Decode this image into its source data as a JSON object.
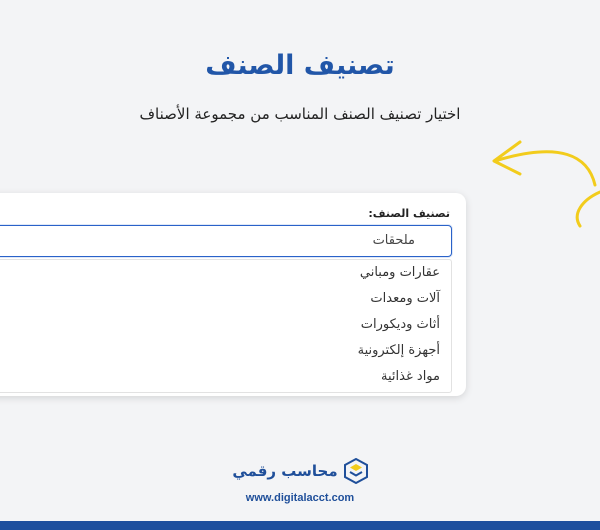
{
  "header": {
    "title": "تصنيف الصنف",
    "subtitle": "اختيار تصنيف الصنف المناسب من مجموعة الأصناف"
  },
  "form": {
    "field_label": "تصنيف الصنف:",
    "selected_value": "ملحقات",
    "options": [
      {
        "label": "عقارات ومباني"
      },
      {
        "label": "آلات ومعدات"
      },
      {
        "label": "أثاث وديكورات"
      },
      {
        "label": "أجهزة إلكترونية"
      },
      {
        "label": "مواد غذائية"
      }
    ]
  },
  "brand": {
    "name": "محاسب رقمي",
    "url": "www.digitalacct.com"
  },
  "colors": {
    "accent": "#2156a8",
    "arrow": "#f2cc1c",
    "focus_border": "#2a62c9",
    "bottom_bar": "#1d4f9e"
  },
  "icons": {
    "decoration": "curved-arrow-icon",
    "logo": "digital-accountant-logo-icon"
  }
}
